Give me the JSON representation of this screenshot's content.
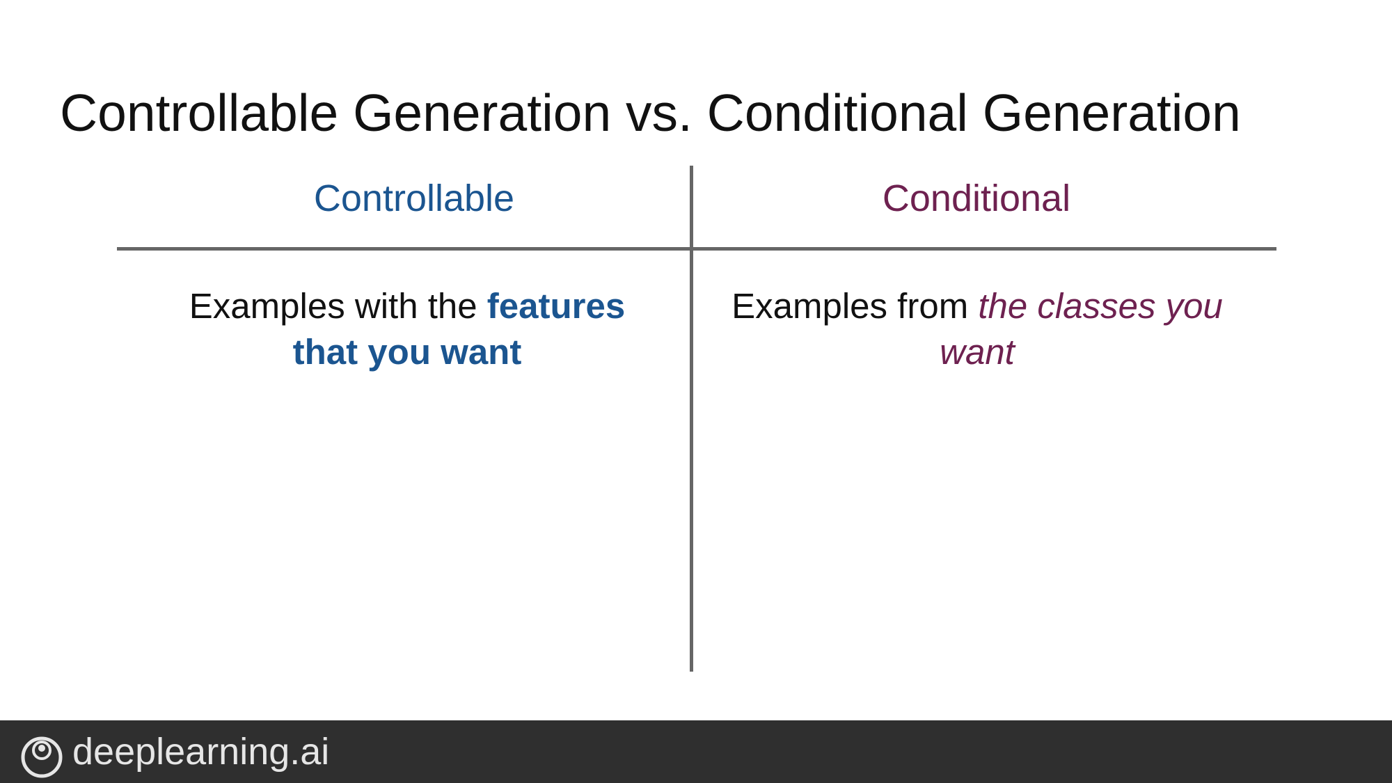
{
  "slide": {
    "title": "Controllable Generation vs. Conditional Generation"
  },
  "columns": {
    "left": {
      "heading": "Controllable",
      "text_plain": "Examples with the ",
      "text_highlight": "features that you want"
    },
    "right": {
      "heading": "Conditional",
      "text_plain": "Examples from ",
      "text_highlight": "the classes you want"
    }
  },
  "footer": {
    "brand": "deeplearning.ai",
    "logo_icon": "deeplearning-ai-logo-icon",
    "background": "#2f2f2f"
  },
  "colors": {
    "controllable_accent": "#1b5590",
    "conditional_accent": "#6e2150",
    "divider": "#666666"
  }
}
